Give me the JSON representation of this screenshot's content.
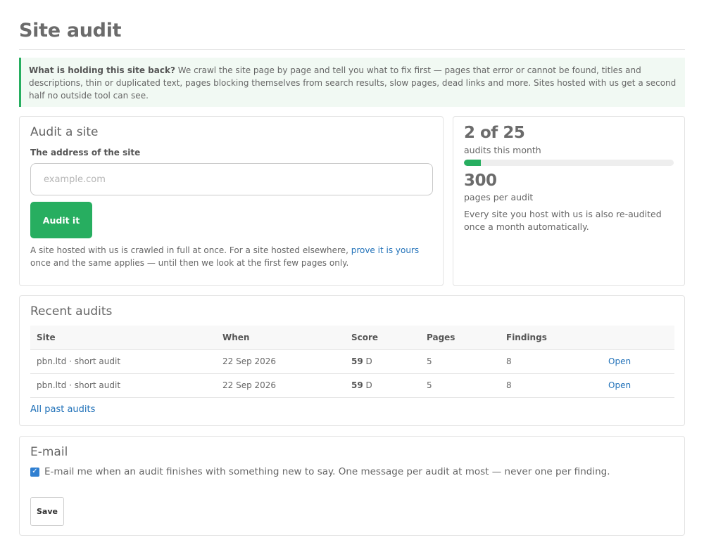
{
  "page": {
    "title": "Site audit"
  },
  "notice": {
    "lead": "What is holding this site back?",
    "body": " We crawl the site page by page and tell you what to fix first — pages that error or cannot be found, titles and descriptions, thin or duplicated text, pages blocking themselves from search results, slow pages, dead links and more. Sites hosted with us get a second half no outside tool can see."
  },
  "audit_form": {
    "heading": "Audit a site",
    "field_label": "The address of the site",
    "placeholder": "example.com",
    "value": "",
    "button_label": "Audit it",
    "note_before": "A site hosted with us is crawled in full at once. For a site hosted elsewhere, ",
    "note_link": "prove it is yours",
    "note_after": " once and the same applies — until then we look at the first few pages only."
  },
  "stats": {
    "audits_count": "2 of 25",
    "audits_label": "audits this month",
    "audits_used": 2,
    "audits_total": 25,
    "pages_count": "300",
    "pages_label": "pages per audit",
    "note": "Every site you host with us is also re-audited once a month automatically."
  },
  "recent": {
    "heading": "Recent audits",
    "columns": [
      "Site",
      "When",
      "Score",
      "Pages",
      "Findings",
      ""
    ],
    "rows": [
      {
        "site": "pbn.ltd · short audit",
        "when": "22 Sep 2026",
        "score": "59",
        "grade": "D",
        "pages": "5",
        "findings": "8",
        "action": "Open"
      },
      {
        "site": "pbn.ltd · short audit",
        "when": "22 Sep 2026",
        "score": "59",
        "grade": "D",
        "pages": "5",
        "findings": "8",
        "action": "Open"
      }
    ],
    "all_link": "All past audits"
  },
  "email": {
    "heading": "E-mail",
    "checked": true,
    "option_label": "E-mail me when an audit finishes with something new to say. One message per audit at most — never one per finding.",
    "save_label": "Save"
  },
  "colors": {
    "accent": "#27ae60",
    "link": "#2272b9",
    "checkbox": "#2f7fd1",
    "notice_bg": "#f1f9f3"
  },
  "icons": {
    "checkbox": "check-icon"
  }
}
